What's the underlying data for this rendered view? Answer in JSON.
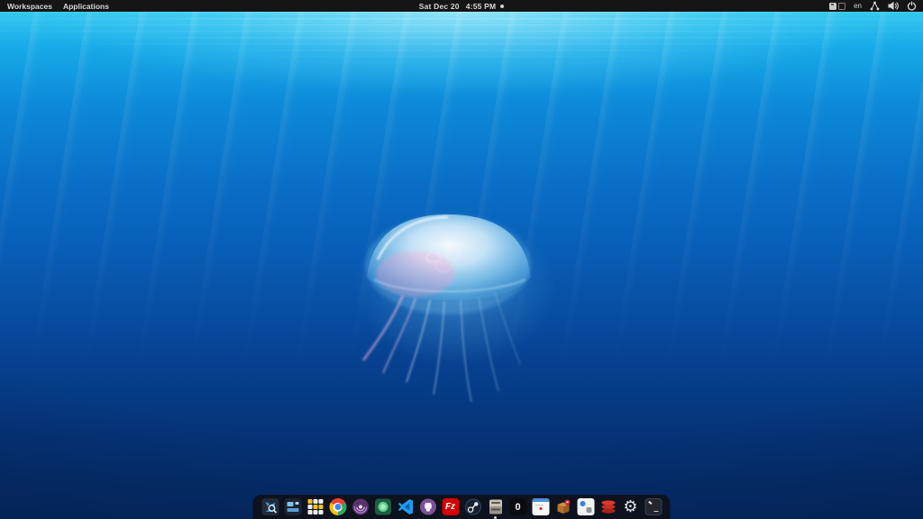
{
  "panel": {
    "menus": [
      {
        "label": "Workspaces"
      },
      {
        "label": "Applications"
      }
    ],
    "clock": {
      "date": "Sat Dec 20",
      "time": "4:55 PM"
    },
    "has_notification_dot": true,
    "tray": {
      "keyboard_layout": "en",
      "icons": [
        "workspace-pager-icon",
        "keyboard-layout-indicator",
        "network-share-icon",
        "volume-icon",
        "power-icon"
      ]
    },
    "colors": {
      "background": "#151515",
      "text": "#d6d6d6"
    }
  },
  "wallpaper": {
    "description": "underwater ocean scene with a moon jellyfish and sun rays from the surface",
    "colors": {
      "surface": "#35c8f0",
      "mid": "#0a6ec6",
      "deep": "#042a63",
      "jellyfish_pink": "#f5b8d8"
    }
  },
  "dock": {
    "items": [
      {
        "name": "app-finder"
      },
      {
        "name": "window-layout-app"
      },
      {
        "name": "app-grid-launcher"
      },
      {
        "name": "google-chrome"
      },
      {
        "name": "tor-browser"
      },
      {
        "name": "green-gem-app"
      },
      {
        "name": "vscode"
      },
      {
        "name": "github-desktop"
      },
      {
        "name": "filezilla",
        "icon_text": "Fz"
      },
      {
        "name": "steam"
      },
      {
        "name": "file-cabinet-app",
        "running": true
      },
      {
        "name": "letter-o-app",
        "icon_text": "0"
      },
      {
        "name": "calendar-app"
      },
      {
        "name": "package-box-app"
      },
      {
        "name": "blue-dot-card-app"
      },
      {
        "name": "redis-app"
      },
      {
        "name": "settings",
        "icon_glyph": "⚙"
      },
      {
        "name": "terminal"
      }
    ],
    "colors": {
      "background": "rgba(14,16,22,0.88)",
      "chrome_blue": "#4285f4",
      "tor_purple": "#7d4698",
      "filezilla_red": "#d40000",
      "redis_red": "#d82c20"
    }
  }
}
